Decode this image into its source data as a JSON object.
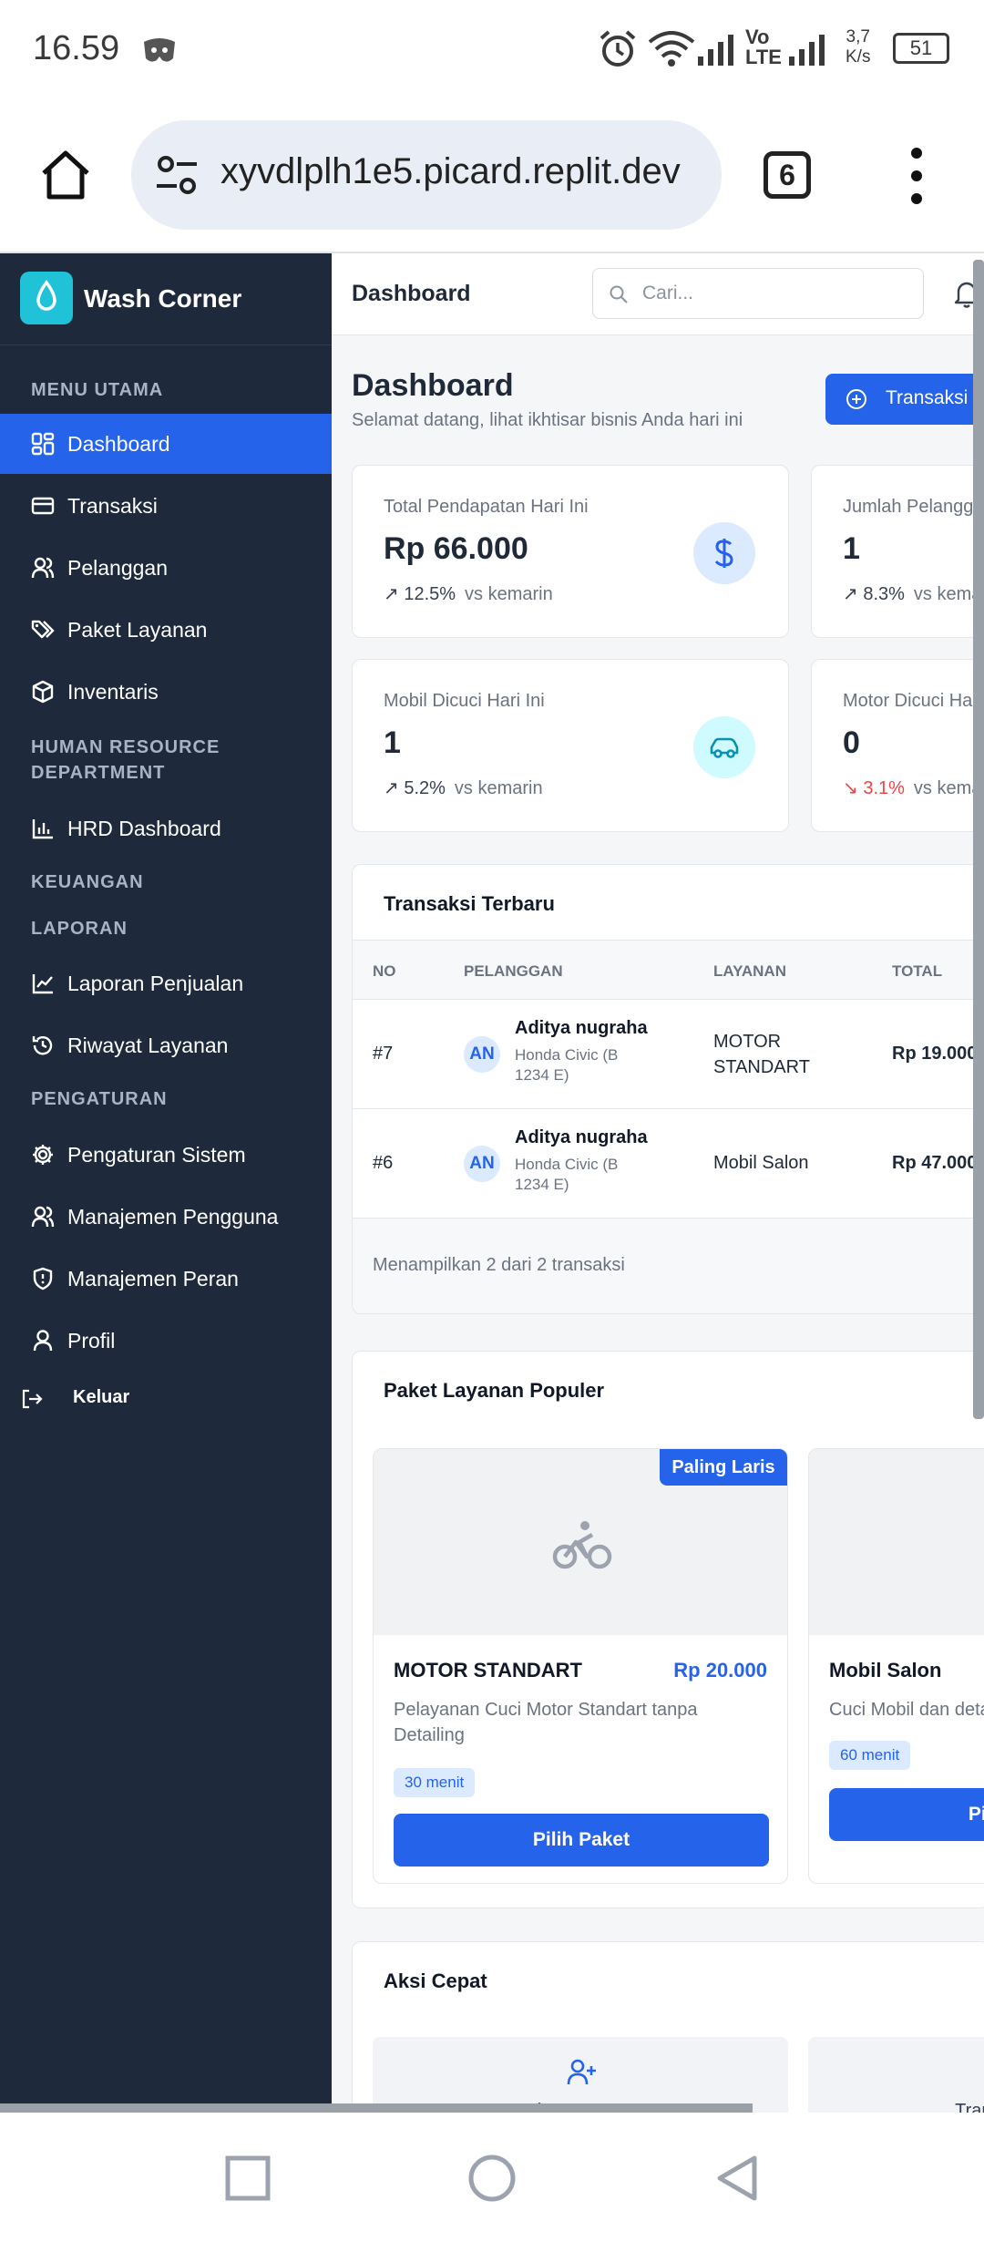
{
  "status_bar": {
    "time": "16.59",
    "network_label_top": "Vo",
    "network_label_bottom": "LTE",
    "speed_top": "3,7",
    "speed_bottom": "K/s",
    "battery": "51"
  },
  "browser": {
    "url": "xyvdlplh1e5.picard.replit.dev",
    "tab_count": "6"
  },
  "sidebar": {
    "brand": "Wash Corner",
    "sections": {
      "main": "MENU UTAMA",
      "hr_line1": "HUMAN RESOURCE",
      "hr_line2": "DEPARTMENT",
      "finance": "KEUANGAN",
      "reports": "LAPORAN",
      "settings": "PENGATURAN"
    },
    "items": {
      "dashboard": "Dashboard",
      "transactions": "Transaksi",
      "customers": "Pelanggan",
      "packages": "Paket Layanan",
      "inventory": "Inventaris",
      "hrd": "HRD Dashboard",
      "sales_report": "Laporan Penjualan",
      "service_history": "Riwayat Layanan",
      "system_settings": "Pengaturan Sistem",
      "user_management": "Manajemen Pengguna",
      "role_management": "Manajemen Peran",
      "profile": "Profil",
      "logout": "Keluar"
    }
  },
  "topbar": {
    "title": "Dashboard",
    "search_placeholder": "Cari..."
  },
  "page": {
    "title": "Dashboard",
    "subtitle": "Selamat datang, lihat ikhtisar bisnis Anda hari ini",
    "new_transaction_button": "Transaksi Baru"
  },
  "stats": [
    {
      "label": "Total Pendapatan Hari Ini",
      "value": "Rp 66.000",
      "change": "12.5%",
      "compare": "vs kemarin"
    },
    {
      "label": "Jumlah Pelanggan",
      "value": "1",
      "change": "8.3%",
      "compare": "vs kemarin"
    },
    {
      "label": "Mobil Dicuci Hari Ini",
      "value": "1",
      "change": "5.2%",
      "compare": "vs kemarin"
    },
    {
      "label": "Motor Dicuci Hari Ini",
      "value": "0",
      "change": "3.1%",
      "compare": "vs kemarin"
    }
  ],
  "colors": {
    "sidebar": "#1e293b",
    "accent": "#2563eb",
    "teal": "#1fc2d6",
    "negative": "#ef4444"
  },
  "transactions": {
    "title": "Transaksi Terbaru",
    "columns": [
      "NO",
      "PELANGGAN",
      "LAYANAN",
      "TOTAL"
    ],
    "rows": [
      {
        "no": "#7",
        "initials": "AN",
        "name": "Aditya nugraha",
        "vehicle": "Honda Civic (B 1234 E)",
        "service": "MOTOR STANDART",
        "total": "Rp 19.000"
      },
      {
        "no": "#6",
        "initials": "AN",
        "name": "Aditya nugraha",
        "vehicle": "Honda Civic (B 1234 E)",
        "service": "Mobil Salon",
        "total": "Rp 47.000"
      }
    ],
    "footer": "Menampilkan 2 dari 2 transaksi"
  },
  "packages": {
    "title": "Paket Layanan Populer",
    "items": [
      {
        "ribbon": "Paling Laris",
        "name": "MOTOR STANDART",
        "price": "Rp 20.000",
        "description": "Pelayanan Cuci Motor Standart tanpa Detailing",
        "duration": "30 menit",
        "button": "Pilih Paket"
      },
      {
        "name": "Mobil Salon",
        "description": "Cuci Mobil dan detailing",
        "duration": "60 menit",
        "button": "Pilih Paket"
      }
    ]
  },
  "quick_actions": {
    "title": "Aksi Cepat",
    "items": [
      {
        "label": "Pelanggan Baru"
      },
      {
        "label": "Transaksi Baru"
      }
    ]
  }
}
